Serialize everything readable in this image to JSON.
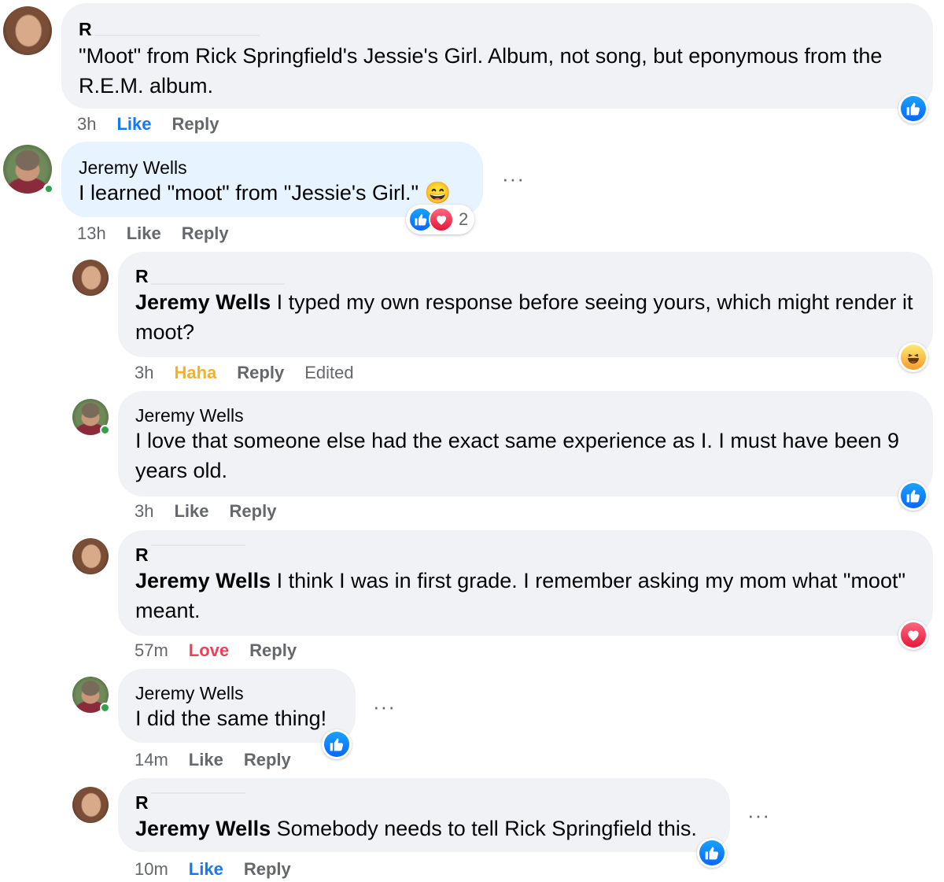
{
  "comments": [
    {
      "author": "R",
      "text": "\"Moot\" from Rick Springfield's Jessie's Girl. Album, not song, but eponymous from the R.E.M. album.",
      "time": "3h",
      "like": "Like",
      "reply": "Reply",
      "reaction": "like-icon"
    },
    {
      "author": "Jeremy Wells",
      "text": "I learned \"moot\" from \"Jessie's Girl.\"",
      "emoji": "😄",
      "time": "13h",
      "like": "Like",
      "reply": "Reply",
      "reaction_count": "2",
      "more": "···"
    },
    {
      "author": "R",
      "tag": "Jeremy Wells",
      "text": " I typed my own response before seeing yours, which might render it moot?",
      "time": "3h",
      "like": "Haha",
      "reply": "Reply",
      "edited": "Edited",
      "reaction": "haha-icon"
    },
    {
      "author": "Jeremy Wells",
      "text": "I love that someone else had the exact same experience as I. I must have been 9 years old.",
      "time": "3h",
      "like": "Like",
      "reply": "Reply",
      "reaction": "like-icon"
    },
    {
      "author": "R",
      "tag": "Jeremy Wells",
      "text": " I think I was in first grade. I remember asking my mom what \"moot\" meant.",
      "time": "57m",
      "like": "Love",
      "reply": "Reply",
      "reaction": "love-icon"
    },
    {
      "author": "Jeremy Wells",
      "text": "I did the same thing!",
      "time": "14m",
      "like": "Like",
      "reply": "Reply",
      "reaction": "like-icon",
      "more": "···"
    },
    {
      "author": "R",
      "tag": "Jeremy Wells",
      "text": " Somebody needs to tell Rick Springfield this.",
      "time": "10m",
      "like": "Like",
      "reply": "Reply",
      "reaction": "like-icon",
      "more": "···"
    }
  ],
  "colors": {
    "like": "#1877f2",
    "haha": "#f7b125",
    "love": "#f33e58",
    "bubble": "#f0f2f5",
    "bubble_highlight": "#e7f3ff",
    "meta": "#65676b"
  }
}
